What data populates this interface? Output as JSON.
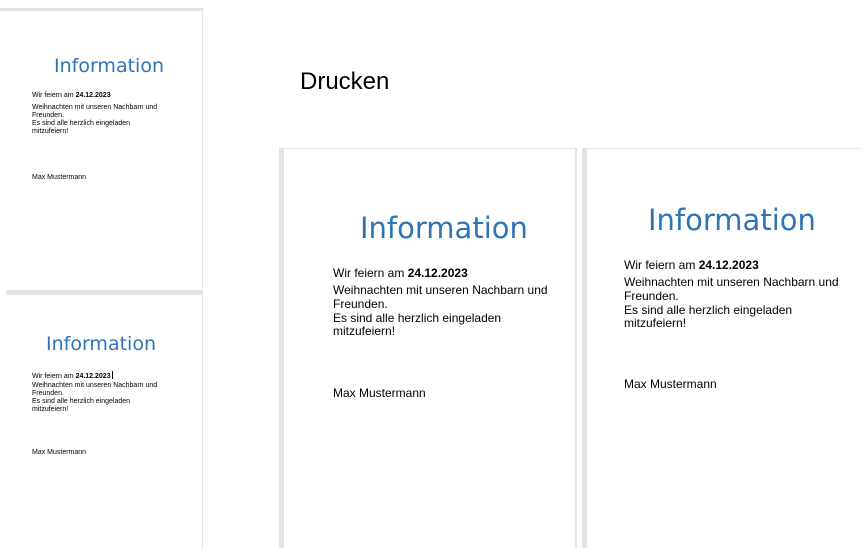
{
  "heading": "Drucken",
  "document": {
    "title": "Information",
    "line1_prefix": "Wir feiern am ",
    "line1_date": "24.12.2023",
    "para_line1": "Weihnachten mit unseren Nachbarn und",
    "para_line2": "Freunden.",
    "para_line3": "Es sind alle herzlich eingeladen",
    "para_line4": "mitzufeiern!",
    "signature": "Max Mustermann"
  },
  "colors": {
    "title": "#2e74b5",
    "page_border": "#e3e3e3"
  }
}
